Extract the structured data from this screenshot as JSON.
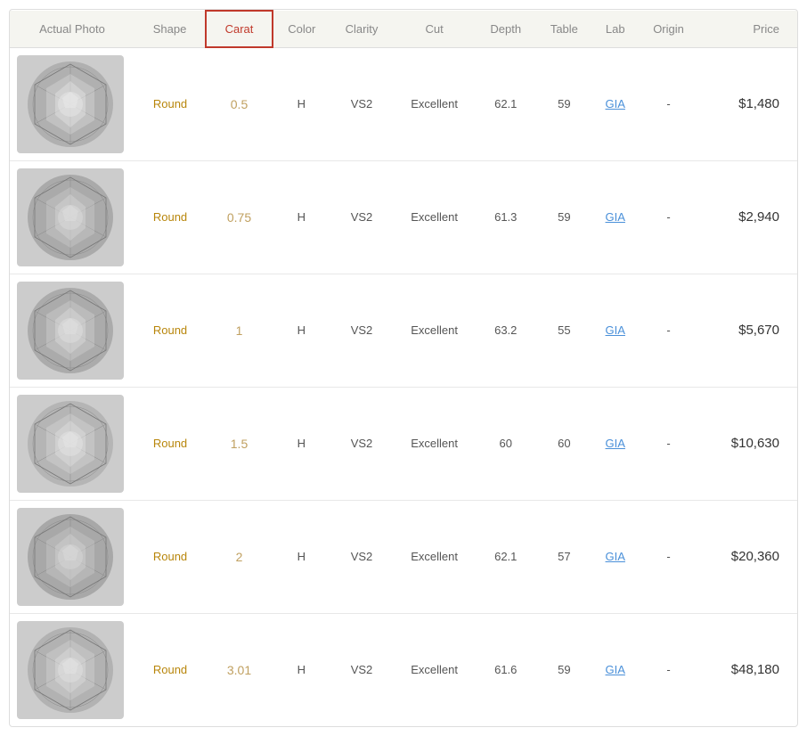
{
  "table": {
    "headers": {
      "photo": "Actual Photo",
      "shape": "Shape",
      "carat": "Carat",
      "color": "Color",
      "clarity": "Clarity",
      "cut": "Cut",
      "depth": "Depth",
      "table": "Table",
      "lab": "Lab",
      "origin": "Origin",
      "price": "Price"
    },
    "rows": [
      {
        "shape": "Round",
        "carat": "0.5",
        "color": "H",
        "clarity": "VS2",
        "cut": "Excellent",
        "depth": "62.1",
        "table": "59",
        "lab": "GIA",
        "origin": "-",
        "price": "$1,480"
      },
      {
        "shape": "Round",
        "carat": "0.75",
        "color": "H",
        "clarity": "VS2",
        "cut": "Excellent",
        "depth": "61.3",
        "table": "59",
        "lab": "GIA",
        "origin": "-",
        "price": "$2,940"
      },
      {
        "shape": "Round",
        "carat": "1",
        "color": "H",
        "clarity": "VS2",
        "cut": "Excellent",
        "depth": "63.2",
        "table": "55",
        "lab": "GIA",
        "origin": "-",
        "price": "$5,670"
      },
      {
        "shape": "Round",
        "carat": "1.5",
        "color": "H",
        "clarity": "VS2",
        "cut": "Excellent",
        "depth": "60",
        "table": "60",
        "lab": "GIA",
        "origin": "-",
        "price": "$10,630"
      },
      {
        "shape": "Round",
        "carat": "2",
        "color": "H",
        "clarity": "VS2",
        "cut": "Excellent",
        "depth": "62.1",
        "table": "57",
        "lab": "GIA",
        "origin": "-",
        "price": "$20,360"
      },
      {
        "shape": "Round",
        "carat": "3.01",
        "color": "H",
        "clarity": "VS2",
        "cut": "Excellent",
        "depth": "61.6",
        "table": "59",
        "lab": "GIA",
        "origin": "-",
        "price": "$48,180"
      }
    ]
  }
}
